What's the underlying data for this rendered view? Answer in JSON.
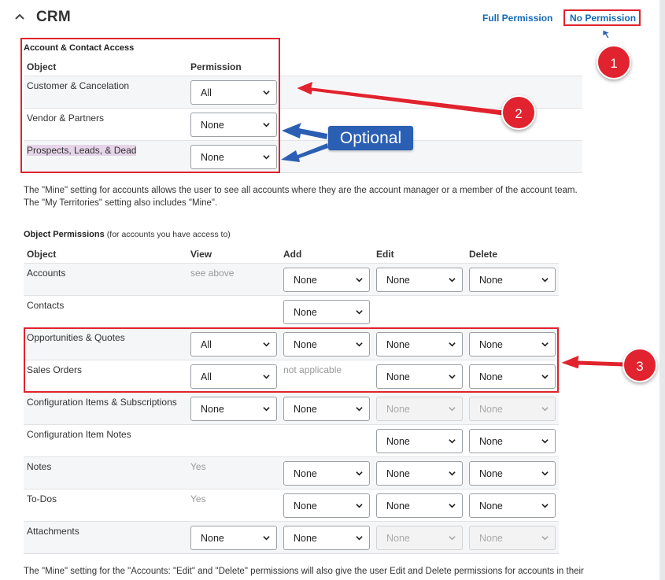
{
  "header": {
    "title": "CRM",
    "full_permission": "Full Permission",
    "no_permission": "No Permission"
  },
  "account_access": {
    "title": "Account & Contact Access",
    "col_object": "Object",
    "col_permission": "Permission",
    "rows": [
      {
        "object": "Customer & Cancelation",
        "permission": "All"
      },
      {
        "object": "Vendor & Partners",
        "permission": "None"
      },
      {
        "object": "Prospects, Leads, & Dead",
        "permission": "None"
      }
    ]
  },
  "note1_line1": "The \"Mine\" setting for accounts allows the user to see all accounts where they are the account manager or a member of the account team.",
  "note1_line2": "The \"My Territories\" setting also includes \"Mine\".",
  "object_permissions": {
    "title": "Object Permissions",
    "subtitle": "(for accounts you have access to)",
    "columns": {
      "object": "Object",
      "view": "View",
      "add": "Add",
      "edit": "Edit",
      "delete": "Delete"
    },
    "rows": [
      {
        "object": "Accounts",
        "view_text": "see above",
        "add": "None",
        "edit": "None",
        "delete": "None"
      },
      {
        "object": "Contacts",
        "add": "None"
      },
      {
        "object": "Opportunities & Quotes",
        "view": "All",
        "add": "None",
        "edit": "None",
        "delete": "None"
      },
      {
        "object": "Sales Orders",
        "view": "All",
        "add_text": "not applicable",
        "edit": "None",
        "delete": "None"
      },
      {
        "object": "Configuration Items & Subscriptions",
        "view": "None",
        "add": "None",
        "edit": "None",
        "delete": "None"
      },
      {
        "object": "Configuration Item Notes",
        "edit": "None",
        "delete": "None"
      },
      {
        "object": "Notes",
        "view_text": "Yes",
        "add": "None",
        "edit": "None",
        "delete": "None"
      },
      {
        "object": "To-Dos",
        "view_text": "Yes",
        "add": "None",
        "edit": "None",
        "delete": "None"
      },
      {
        "object": "Attachments",
        "view": "None",
        "add": "None",
        "edit": "None",
        "delete": "None"
      }
    ]
  },
  "note2_line1": "The \"Mine\" setting for the \"Accounts: \"Edit\" and \"Delete\" permissions will also give the user Edit and Delete permissions for accounts in their",
  "annotations": {
    "badge1": "1",
    "badge2": "2",
    "badge3": "3",
    "optional": "Optional"
  },
  "colors": {
    "link": "#1469b5",
    "annotation_red": "#e0232e",
    "annotation_blue": "#2b5fb3"
  }
}
